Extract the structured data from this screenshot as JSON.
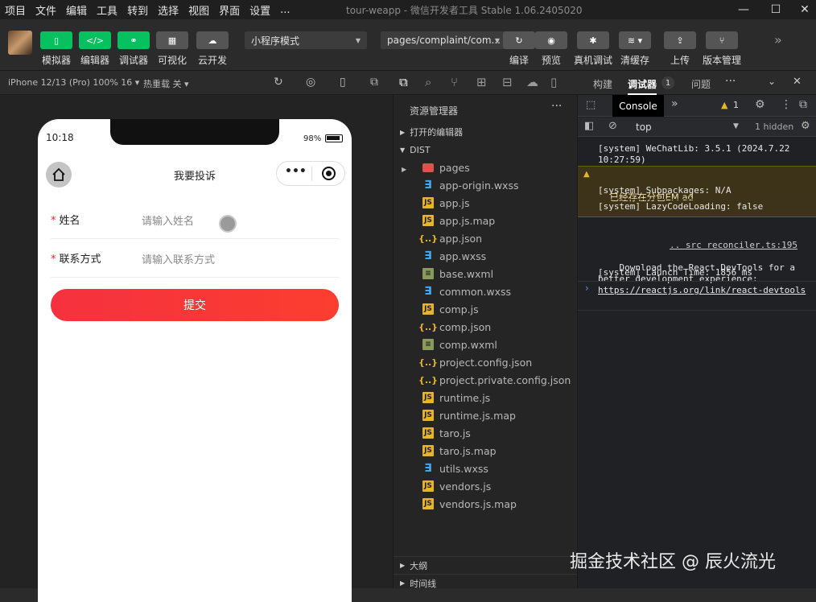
{
  "menubar": {
    "items": [
      "项目",
      "文件",
      "编辑",
      "工具",
      "转到",
      "选择",
      "视图",
      "界面",
      "设置",
      "..."
    ],
    "title": "tour-weapp - 微信开发者工具 Stable 1.06.2405020"
  },
  "toolbar": {
    "simulator": "模拟器",
    "editor": "编辑器",
    "debugger": "调试器",
    "visual": "可视化",
    "cloud": "云开发",
    "mode_select": "小程序模式",
    "page_select": "pages/complaint/com...",
    "compile": "编译",
    "preview": "预览",
    "remote_debug": "真机调试",
    "clear_cache": "清缓存",
    "upload": "上传",
    "version": "版本管理"
  },
  "simbar": {
    "device": "iPhone 12/13 (Pro) 100% 16",
    "hot_reload": "热重载 关"
  },
  "phone": {
    "time": "10:18",
    "battery": "98%",
    "page_title": "我要投诉",
    "fields": [
      {
        "label": "姓名",
        "placeholder": "请输入姓名"
      },
      {
        "label": "联系方式",
        "placeholder": "请输入联系方式"
      }
    ],
    "required_mark": "*",
    "submit": "提交",
    "submit_gradient": [
      "#f5313f",
      "#fb3e2f"
    ]
  },
  "explorer": {
    "title": "资源管理器",
    "open_editors": "打开的编辑器",
    "root": "DIST",
    "files": [
      {
        "name": "pages",
        "type": "folder"
      },
      {
        "name": "app-origin.wxss",
        "type": "css"
      },
      {
        "name": "app.js",
        "type": "js"
      },
      {
        "name": "app.js.map",
        "type": "js"
      },
      {
        "name": "app.json",
        "type": "json"
      },
      {
        "name": "app.wxss",
        "type": "css"
      },
      {
        "name": "base.wxml",
        "type": "wxml"
      },
      {
        "name": "common.wxss",
        "type": "css"
      },
      {
        "name": "comp.js",
        "type": "js"
      },
      {
        "name": "comp.json",
        "type": "json"
      },
      {
        "name": "comp.wxml",
        "type": "wxml"
      },
      {
        "name": "project.config.json",
        "type": "json"
      },
      {
        "name": "project.private.config.json",
        "type": "json"
      },
      {
        "name": "runtime.js",
        "type": "js"
      },
      {
        "name": "runtime.js.map",
        "type": "js"
      },
      {
        "name": "taro.js",
        "type": "js"
      },
      {
        "name": "taro.js.map",
        "type": "js"
      },
      {
        "name": "utils.wxss",
        "type": "css"
      },
      {
        "name": "vendors.js",
        "type": "js"
      },
      {
        "name": "vendors.js.map",
        "type": "js"
      }
    ],
    "outline": "大纲",
    "timeline": "时间线"
  },
  "debug": {
    "tabs": [
      "构建",
      "调试器",
      "问题"
    ],
    "badge": "1",
    "console_tab": "Console",
    "warning_count": "1",
    "context": "top",
    "hidden": "1 hidden",
    "logs": [
      {
        "text": "[system] WeChatLib: 3.5.1 (2024.7.22\n10:27:59)",
        "level": "info"
      },
      {
        "text": "已经存在分包EM ad",
        "level": "warn"
      },
      {
        "text": "[system] Subpackages: N/A",
        "level": "info"
      },
      {
        "text": "[system] LazyCodeLoading: false",
        "level": "info"
      },
      {
        "source": ".. src reconciler.ts:195",
        "text": "Download the React DevTools for a\nbetter development experience: ",
        "link": "https://reactjs.org/link/react-devtools",
        "level": "info"
      },
      {
        "text": "[system] Launch Time: 1856 ms",
        "level": "info"
      }
    ]
  },
  "watermark": "掘金技术社区 @ 辰火流光"
}
